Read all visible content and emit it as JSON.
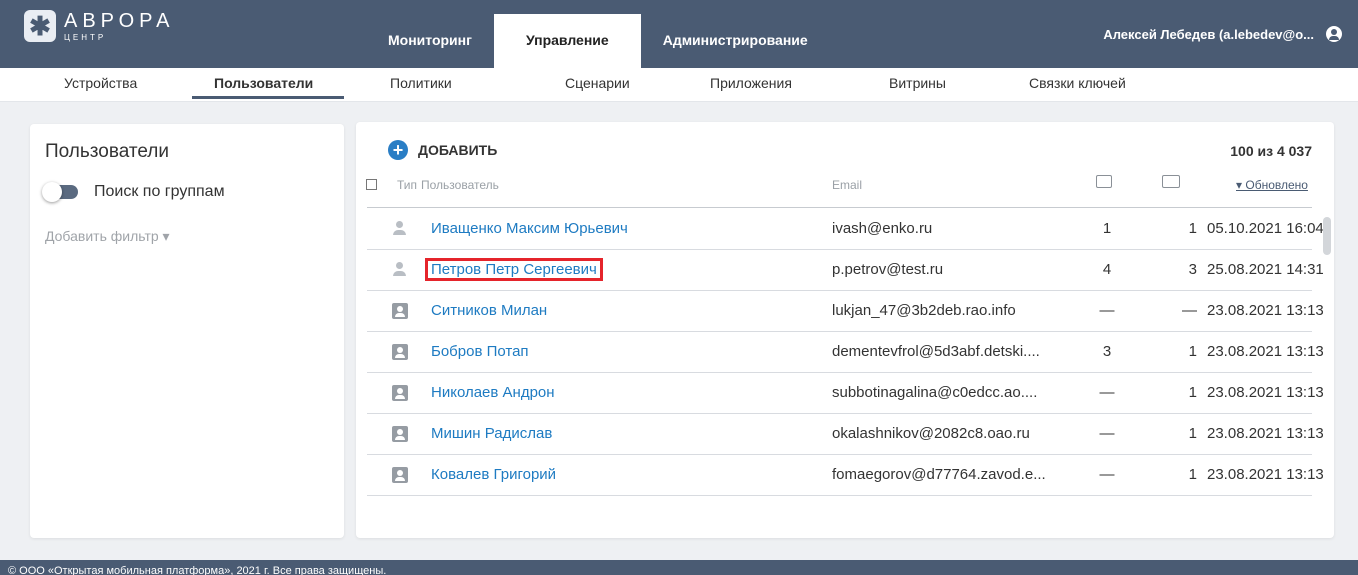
{
  "app": {
    "logo_title": "АВРОРА",
    "logo_subtitle": "ЦЕНТР"
  },
  "main_nav": [
    {
      "label": "Мониторинг"
    },
    {
      "label": "Управление",
      "active": true
    },
    {
      "label": "Администрирование"
    }
  ],
  "user": {
    "name": "Алексей Лебедев (a.lebedev@o...",
    "icon": "account-circle-icon"
  },
  "sub_nav": [
    {
      "label": "Устройства"
    },
    {
      "label": "Пользователи",
      "active": true
    },
    {
      "label": "Политики"
    },
    {
      "label": "Сценарии"
    },
    {
      "label": "Приложения"
    },
    {
      "label": "Витрины"
    },
    {
      "label": "Связки ключей"
    }
  ],
  "filters": {
    "title": "Пользователи",
    "group_search_label": "Поиск по группам",
    "add_filter_label": "Добавить фильтр ▾"
  },
  "toolbar": {
    "add_label": "ДОБАВИТЬ",
    "count_text": "100 из 4 037"
  },
  "table": {
    "headers": {
      "type": "Тип",
      "user": "Пользователь",
      "email": "Email",
      "devices_icon": "device-icon",
      "groups_icon": "folders-icon",
      "updated": "▾ Обновлено"
    },
    "rows": [
      {
        "type": "person",
        "name": "Иващенко Максим Юрьевич",
        "email": "ivash@enko.ru",
        "n1": "1",
        "n2": "1",
        "date": "05.10.2021 16:04"
      },
      {
        "type": "person",
        "name": "Петров Петр Сергеевич",
        "email": "p.petrov@test.ru",
        "n1": "4",
        "n2": "3",
        "date": "25.08.2021 14:31",
        "highlighted": true
      },
      {
        "type": "card",
        "name": "Ситников Милан",
        "email": "lukjan_47@3b2deb.rao.info",
        "n1": "—",
        "n2": "—",
        "date": "23.08.2021 13:13"
      },
      {
        "type": "card",
        "name": "Бобров Потап",
        "email": "dementevfrol@5d3abf.detski....",
        "n1": "3",
        "n2": "1",
        "date": "23.08.2021 13:13"
      },
      {
        "type": "card",
        "name": "Николаев Андрон",
        "email": "subbotinagalina@c0edcc.ao....",
        "n1": "—",
        "n2": "1",
        "date": "23.08.2021 13:13"
      },
      {
        "type": "card",
        "name": "Мишин Радислав",
        "email": "okalashnikov@2082c8.oao.ru",
        "n1": "—",
        "n2": "1",
        "date": "23.08.2021 13:13"
      },
      {
        "type": "card",
        "name": "Ковалев Григорий",
        "email": "fomaegorov@d77764.zavod.e...",
        "n1": "—",
        "n2": "1",
        "date": "23.08.2021 13:13"
      }
    ]
  },
  "footer": {
    "text": "© ООО «Открытая мобильная платформа», 2021 г. Все права защищены."
  },
  "colors": {
    "header_bg": "#4a5b73",
    "link": "#1e7bc2",
    "accent_add": "#2a7ec5",
    "highlight_box": "#e5242b"
  }
}
